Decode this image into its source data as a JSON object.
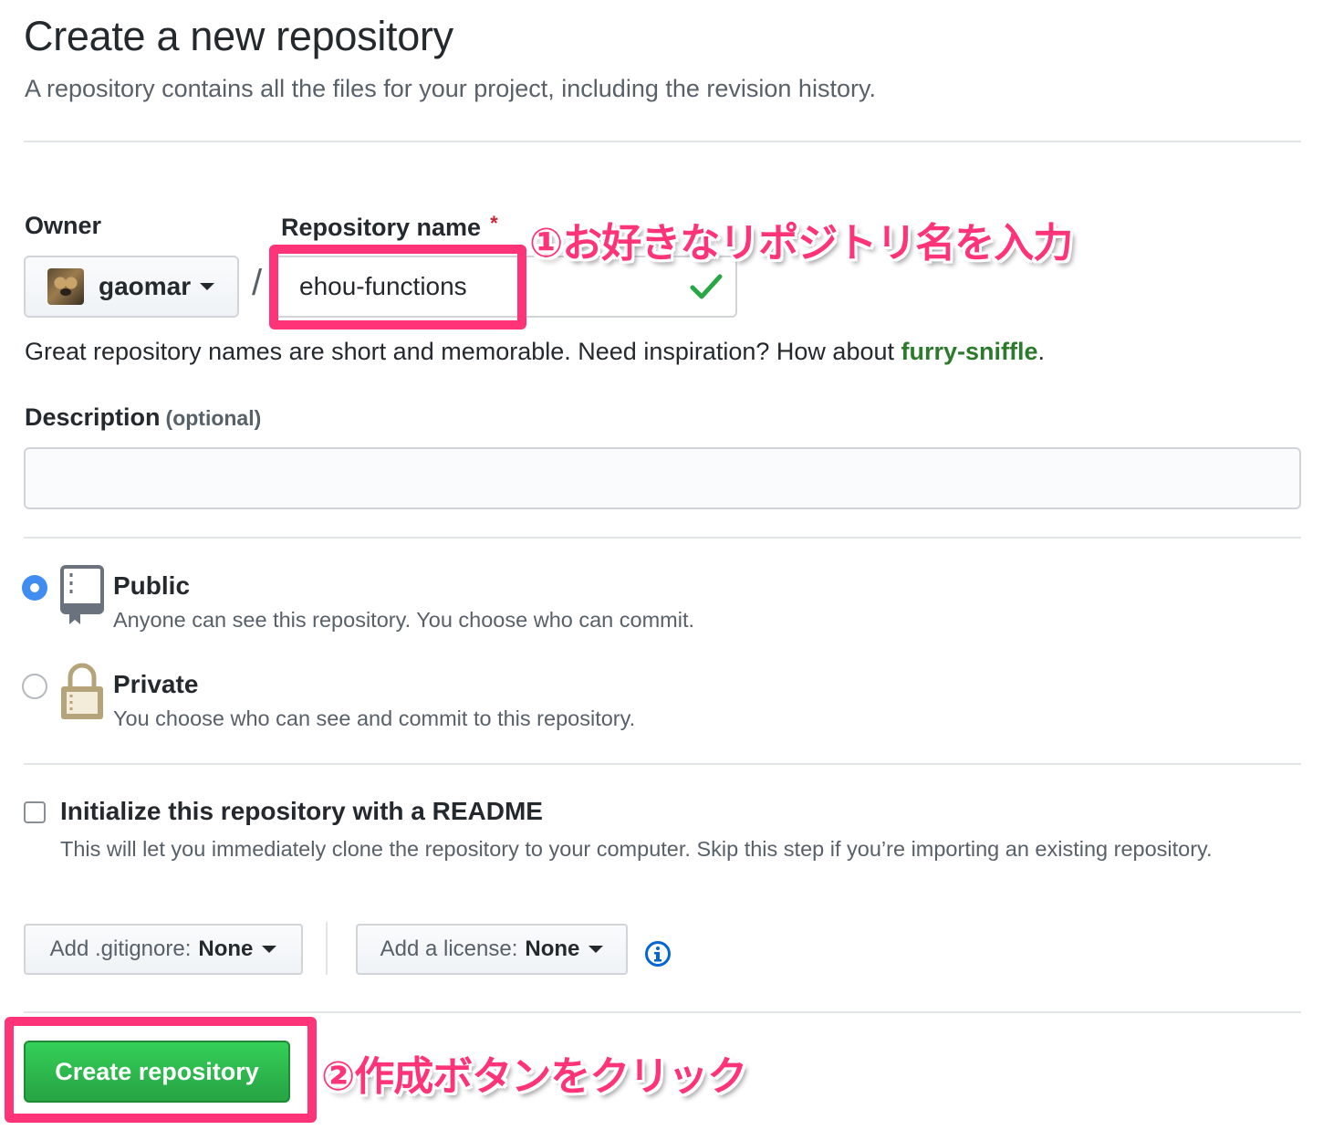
{
  "header": {
    "title": "Create a new repository",
    "subtitle": "A repository contains all the files for your project, including the revision history."
  },
  "owner": {
    "label": "Owner",
    "selected": "gaomar"
  },
  "repo_name": {
    "label": "Repository name",
    "required_mark": "*",
    "value": "ehou-functions",
    "slash": "/"
  },
  "hint": {
    "prefix": "Great repository names are short and memorable. Need inspiration? How about ",
    "suggestion": "furry-sniffle",
    "suffix": "."
  },
  "description": {
    "label": "Description",
    "optional": "(optional)",
    "value": ""
  },
  "visibility": {
    "selected": "public",
    "public": {
      "title": "Public",
      "desc": "Anyone can see this repository. You choose who can commit."
    },
    "private": {
      "title": "Private",
      "desc": "You choose who can see and commit to this repository."
    }
  },
  "readme": {
    "checked": false,
    "title": "Initialize this repository with a README",
    "desc": "This will let you immediately clone the repository to your computer. Skip this step if you’re importing an existing repository."
  },
  "gitignore": {
    "label": "Add .gitignore:",
    "value": "None"
  },
  "license": {
    "label": "Add a license:",
    "value": "None"
  },
  "submit": {
    "label": "Create repository"
  },
  "annotations": {
    "step1": "①お好きなリポジトリ名を入力",
    "step2": "②作成ボタンをクリック",
    "color": "#ff3377"
  },
  "colors": {
    "primary_button": "#28a745",
    "link_green": "#2c7a2c",
    "radio_selected": "#3f8df1",
    "check": "#28a745",
    "info": "#0366d6",
    "lock": "#b5a37a"
  },
  "icons": {
    "owner_avatar": "avatar",
    "caret": "caret-down-icon",
    "check": "check-icon",
    "public": "repo-icon",
    "private": "lock-icon",
    "info": "info-icon"
  }
}
